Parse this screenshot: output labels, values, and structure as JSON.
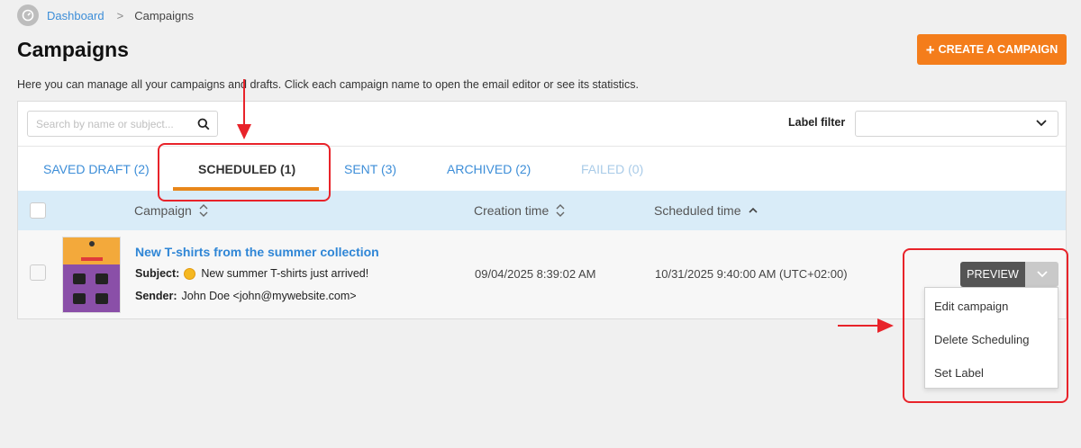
{
  "breadcrumb": {
    "home_icon": "speedometer-icon",
    "link": "Dashboard",
    "separator": ">",
    "current": "Campaigns"
  },
  "page": {
    "title": "Campaigns",
    "create_button": "CREATE A CAMPAIGN",
    "create_button_prefix": "+",
    "description": "Here you can manage all your campaigns and drafts. Click each campaign name to open the email editor or see its statistics."
  },
  "toolbar": {
    "search_placeholder": "Search by name or subject...",
    "label_filter": "Label filter",
    "label_filter_value": ""
  },
  "tabs": [
    {
      "label": "SAVED DRAFT (2)",
      "state": "normal"
    },
    {
      "label": "SCHEDULED (1)",
      "state": "active"
    },
    {
      "label": "SENT (3)",
      "state": "normal"
    },
    {
      "label": "ARCHIVED (2)",
      "state": "normal"
    },
    {
      "label": "FAILED (0)",
      "state": "disabled"
    }
  ],
  "table": {
    "headers": {
      "campaign": "Campaign",
      "creation_time": "Creation time",
      "scheduled_time": "Scheduled time"
    },
    "rows": [
      {
        "name": "New T-shirts from the summer collection",
        "subject_label": "Subject:",
        "subject": "New summer T-shirts just arrived!",
        "sender_label": "Sender:",
        "sender": "John Doe <john@mywebsite.com>",
        "creation_time": "09/04/2025 8:39:02 AM",
        "scheduled_time": "10/31/2025 9:40:00 AM (UTC+02:00)"
      }
    ]
  },
  "actions": {
    "preview": "PREVIEW",
    "menu": [
      "Edit campaign",
      "Delete Scheduling",
      "Set Label"
    ]
  },
  "colors": {
    "accent": "#f47d1b",
    "link": "#3d8ed8",
    "table_header_bg": "#d9ecf8",
    "annotation": "#e8232a",
    "tab_underline": "#e8861a"
  }
}
